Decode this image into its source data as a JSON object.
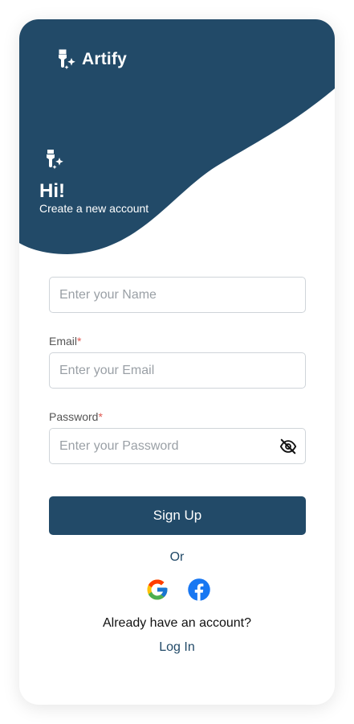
{
  "brand": {
    "name": "Artify",
    "logo_icon": "paintbrush-sparkle-icon"
  },
  "hero": {
    "title": "Hi!",
    "subtitle": "Create a new account",
    "icon": "paintbrush-sparkle-icon"
  },
  "form": {
    "name": {
      "placeholder": "Enter your Name",
      "value": ""
    },
    "email": {
      "label": "Email",
      "required_mark": "*",
      "placeholder": "Enter your Email",
      "value": ""
    },
    "password": {
      "label": "Password",
      "required_mark": "*",
      "placeholder": "Enter your Password",
      "value": "",
      "toggle_icon": "eye-off-icon"
    },
    "submit_label": "Sign Up"
  },
  "divider_text": "Or",
  "social": [
    {
      "name": "google",
      "icon": "google-icon"
    },
    {
      "name": "facebook",
      "icon": "facebook-icon"
    }
  ],
  "footer": {
    "prompt": "Already have an account?",
    "login_label": "Log In"
  },
  "colors": {
    "primary": "#224a68",
    "required": "#e05a52",
    "facebook": "#1877f2"
  }
}
